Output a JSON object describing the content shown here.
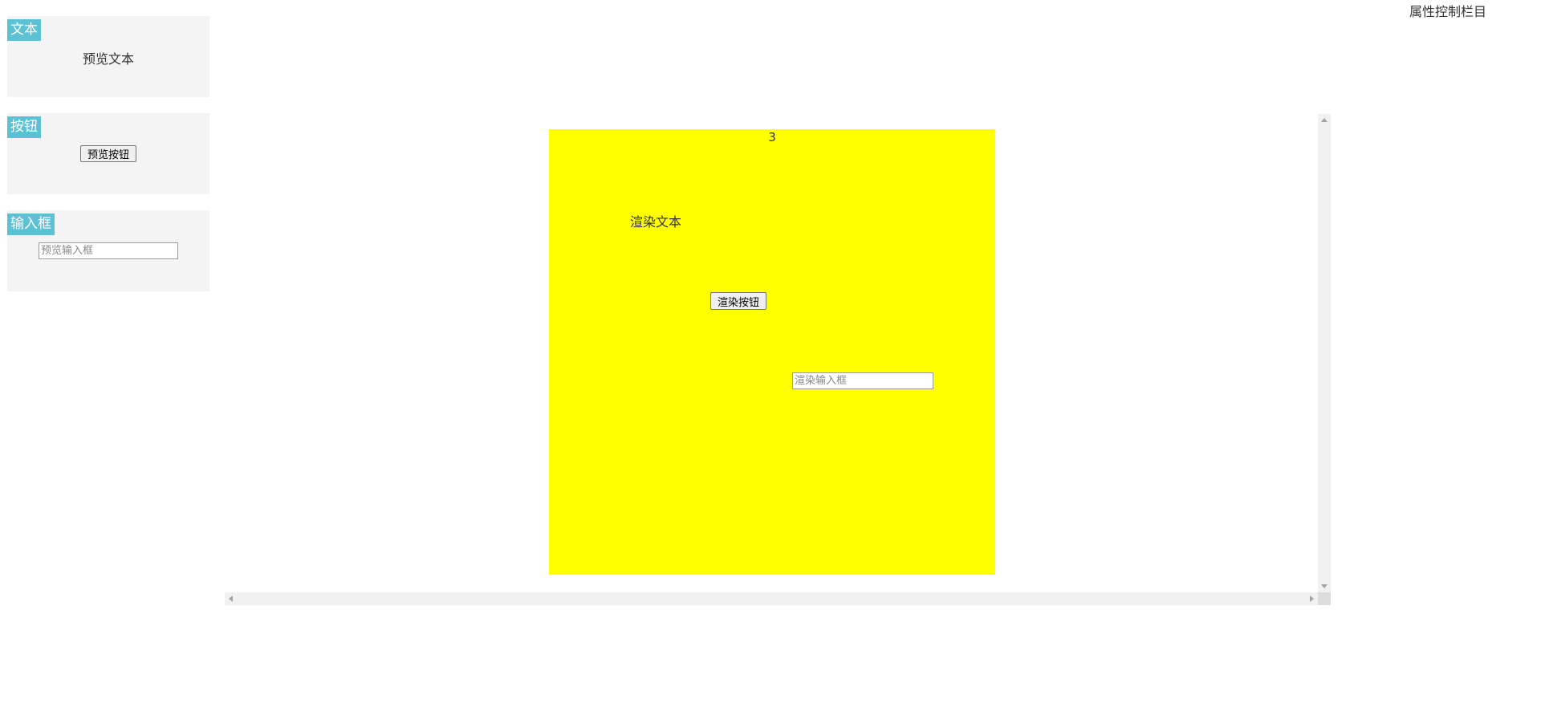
{
  "colors": {
    "tag_background": "#5bc2d6",
    "panel_background": "#f4f4f4",
    "canvas_background": "#ffff00"
  },
  "palette": {
    "text": {
      "tag": "文本",
      "preview": "预览文本"
    },
    "button": {
      "tag": "按钮",
      "preview": "预览按钮"
    },
    "input": {
      "tag": "输入框",
      "placeholder": "预览输入框"
    }
  },
  "properties": {
    "title": "属性控制栏目"
  },
  "canvas": {
    "counter": "3",
    "render_text": "渲染文本",
    "render_button": "渲染按钮",
    "render_input_placeholder": "渲染输入框"
  }
}
